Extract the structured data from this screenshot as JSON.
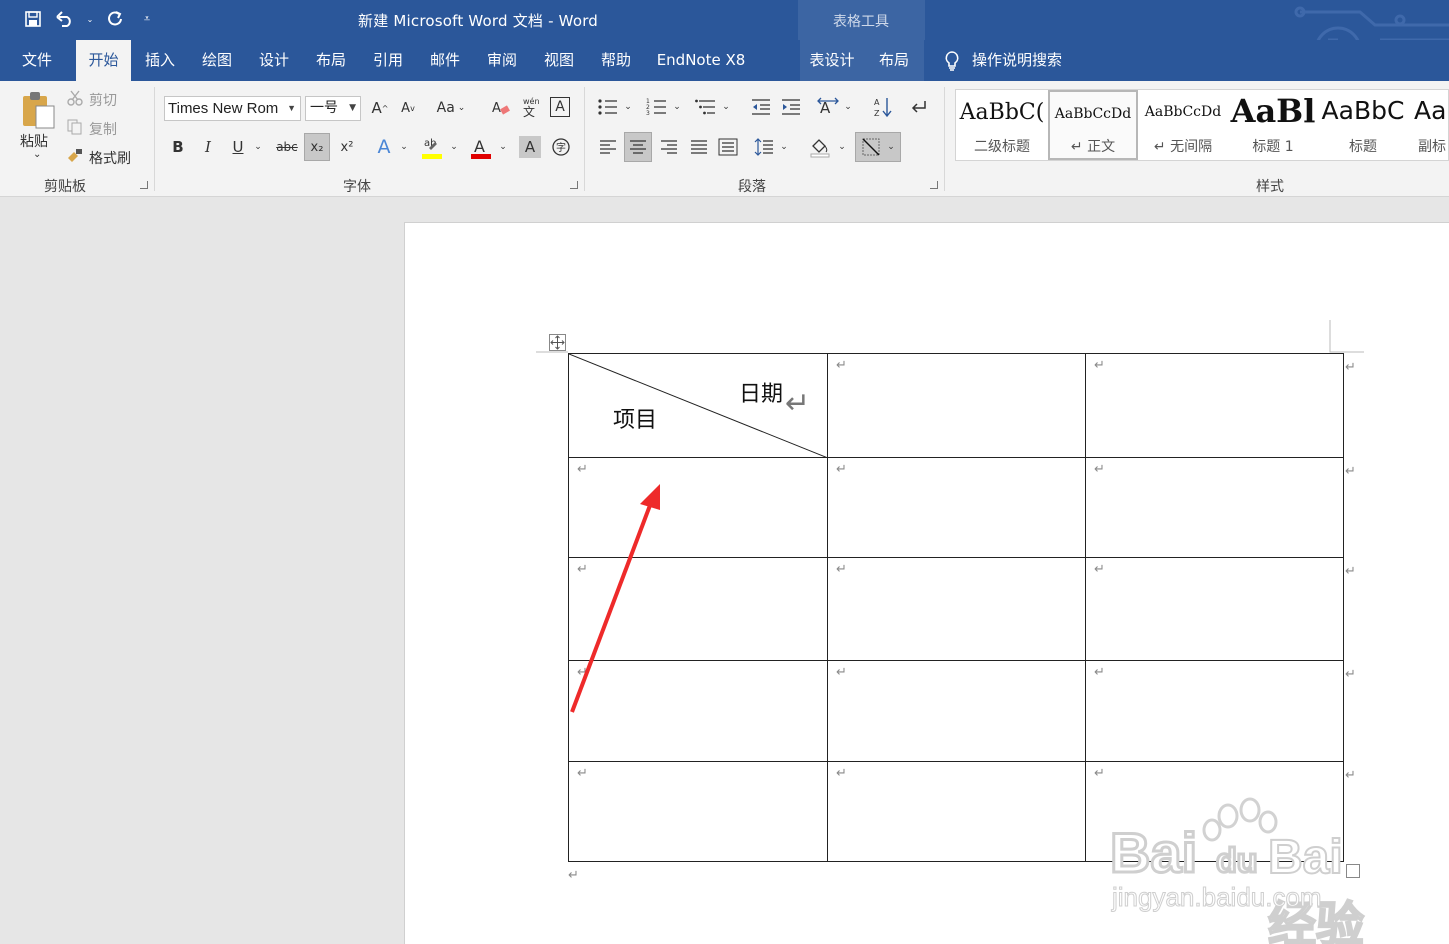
{
  "title_bar": {
    "document_title": "新建 Microsoft Word 文档  -  Word",
    "context_tool_group": "表格工具",
    "qat_icons": [
      "save-icon",
      "undo-icon",
      "redo-icon",
      "customize-qat-icon"
    ]
  },
  "tabs": [
    {
      "label": "文件"
    },
    {
      "label": "开始",
      "active": true
    },
    {
      "label": "插入"
    },
    {
      "label": "绘图"
    },
    {
      "label": "设计"
    },
    {
      "label": "布局"
    },
    {
      "label": "引用"
    },
    {
      "label": "邮件"
    },
    {
      "label": "审阅"
    },
    {
      "label": "视图"
    },
    {
      "label": "帮助"
    },
    {
      "label": "EndNote X8"
    },
    {
      "label": "表设计"
    },
    {
      "label": "布局"
    }
  ],
  "search": {
    "label": "操作说明搜索",
    "icon": "lightbulb-icon"
  },
  "ribbon": {
    "clipboard": {
      "group_label": "剪贴板",
      "paste": "粘贴",
      "cut": "剪切",
      "copy": "复制",
      "format_painter": "格式刷"
    },
    "font": {
      "group_label": "字体",
      "font_name": "Times New Rom",
      "font_size": "一号",
      "change_case": "Aa",
      "bold": "B",
      "italic": "I",
      "underline": "U",
      "strikethrough": "abc",
      "subscript": "x₂",
      "superscript": "x²",
      "highlight_color": "#ffff00",
      "font_color": "#e00000"
    },
    "paragraph": {
      "group_label": "段落"
    },
    "styles": {
      "group_label": "样式",
      "items": [
        {
          "preview": "AaBbC(",
          "name": "二级标题"
        },
        {
          "preview": "AaBbCcDd",
          "name": "↵ 正文",
          "selected": true
        },
        {
          "preview": "AaBbCcDd",
          "name": "↵ 无间隔"
        },
        {
          "preview": "AaBl",
          "name": "标题 1"
        },
        {
          "preview": "AaBbC",
          "name": "标题"
        },
        {
          "preview": "AaI",
          "name": "副标"
        }
      ]
    }
  },
  "document": {
    "table": {
      "rows": 5,
      "cols": 3,
      "diagonal_header": {
        "top_right": "日期",
        "bottom_left": "项目"
      },
      "paragraph_mark": "↵"
    },
    "annotation_arrow_color": "#ee2a2a"
  },
  "watermark": {
    "text": "Bai 经验",
    "subtext": "jingyan.baidu.com"
  },
  "colors": {
    "title_blue": "#2b579a",
    "ribbon_bg": "#f3f3f3",
    "doc_bg": "#e6e6e6"
  }
}
